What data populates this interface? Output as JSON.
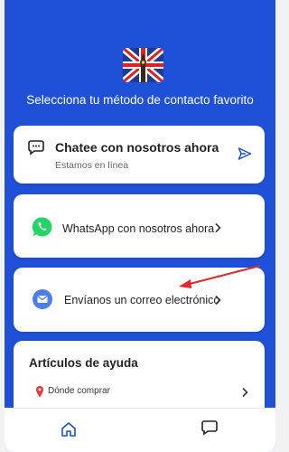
{
  "header": {
    "subtitle": "Selecciona tu método de contacto favorito",
    "flag_icon": "uk-flag-big-ben-icon"
  },
  "chat_card": {
    "title": "Chatee con nosotros ahora",
    "status": "Estamos en línea",
    "icon": "chat-bubble-icon",
    "action_icon": "send-icon"
  },
  "whatsapp_card": {
    "label": "WhatsApp con nosotros ahora",
    "icon": "whatsapp-icon"
  },
  "email_card": {
    "label": "Envíanos un correo electrónico",
    "icon": "mail-icon"
  },
  "help": {
    "title": "Artículos de ayuda",
    "items": [
      {
        "label": "Dónde comprar",
        "icon": "pin-icon"
      }
    ]
  },
  "bottom_nav": {
    "items": [
      {
        "icon": "home-icon"
      },
      {
        "icon": "chat-icon"
      }
    ]
  },
  "colors": {
    "brand": "#1f51d8",
    "accent": "#1a4fc9",
    "whatsapp": "#25d366",
    "annotation": "#e02a2a"
  }
}
